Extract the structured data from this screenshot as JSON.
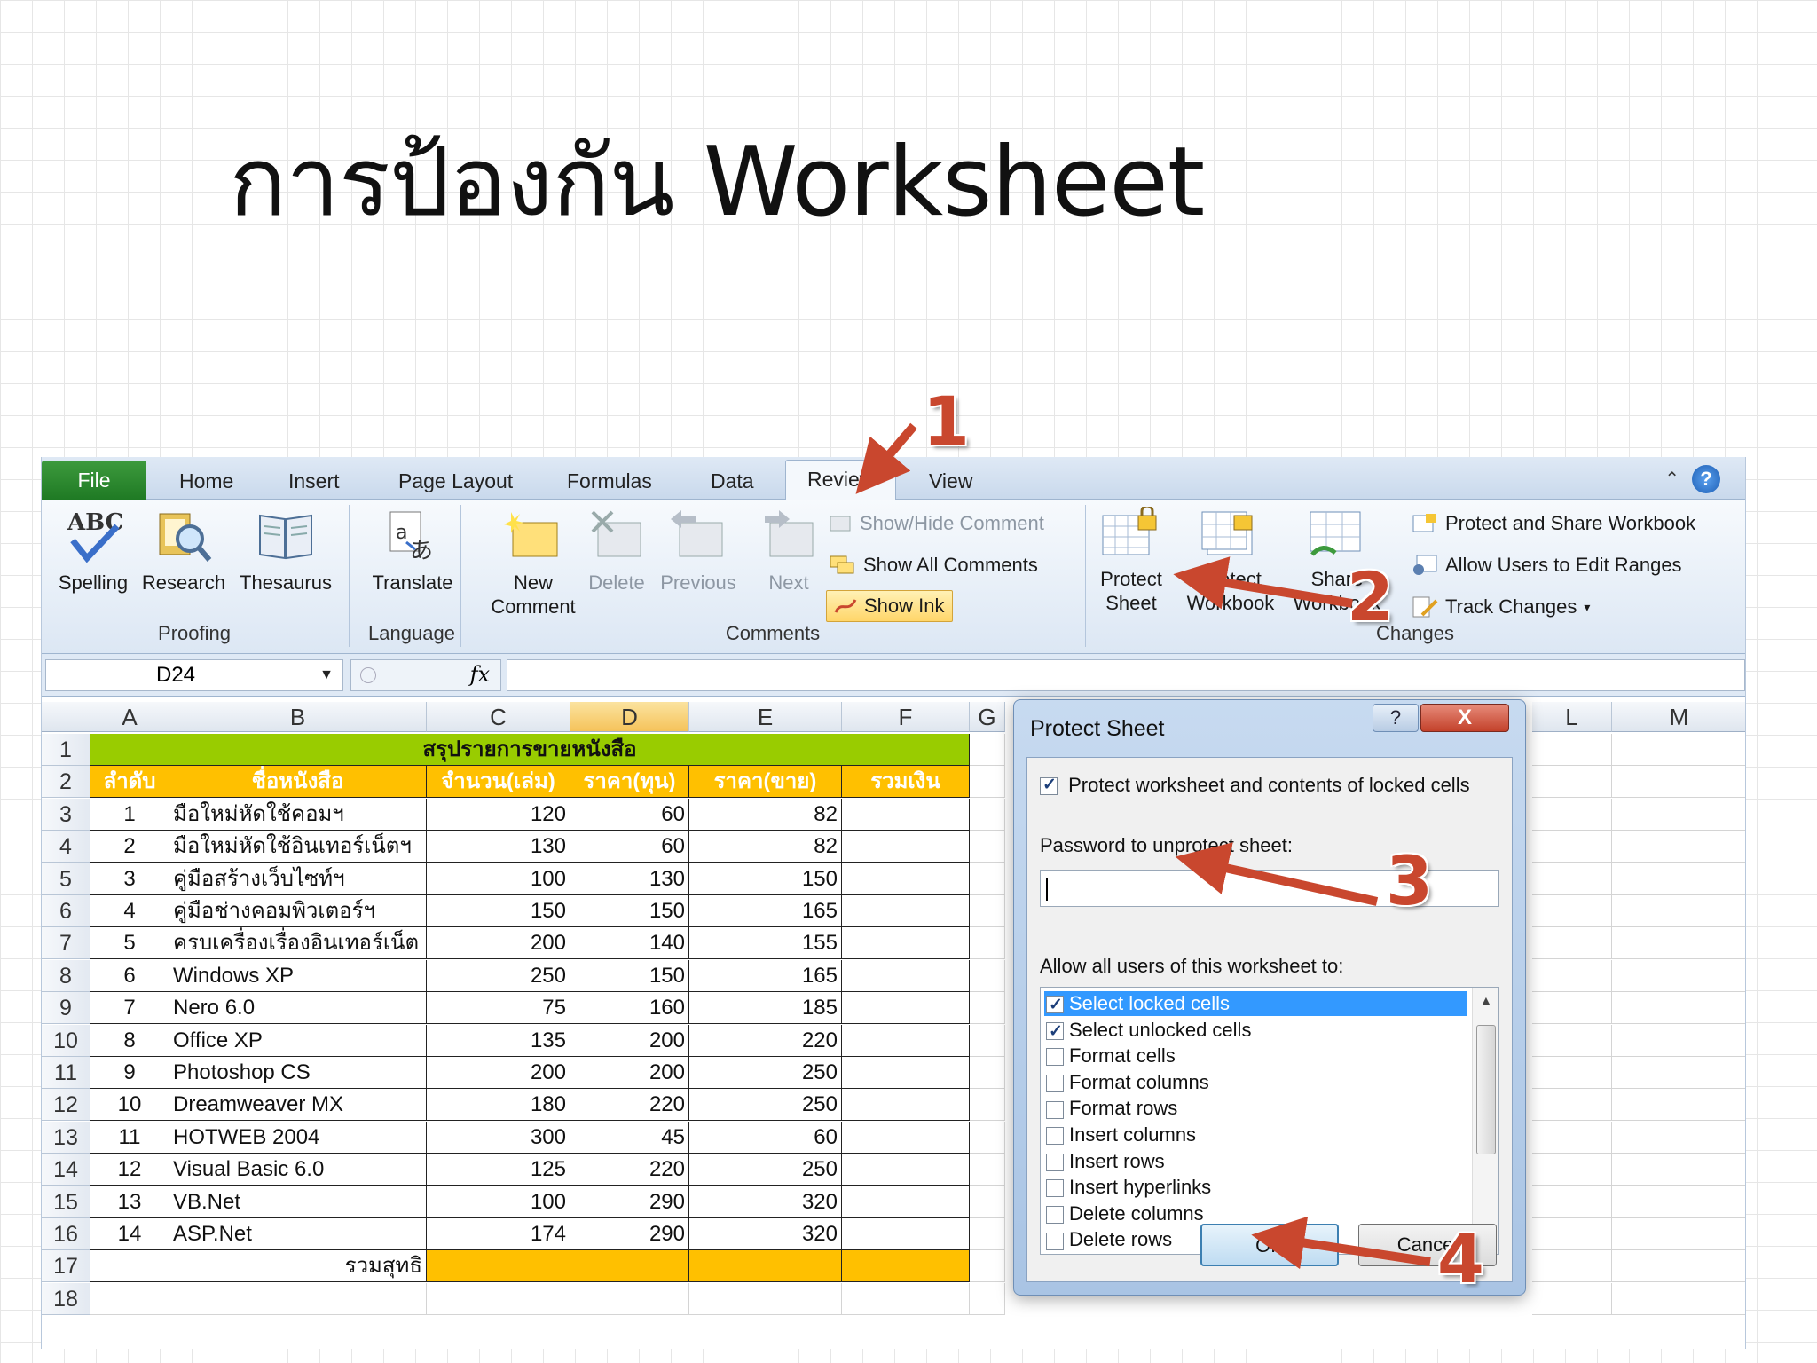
{
  "slide": {
    "title": "การป้องกัน Worksheet"
  },
  "excel": {
    "tabs": [
      "File",
      "Home",
      "Insert",
      "Page Layout",
      "Formulas",
      "Data",
      "Review",
      "View"
    ],
    "active_tab": "Review",
    "ribbon": {
      "proofing": {
        "label": "Proofing",
        "spelling": "Spelling",
        "research": "Research",
        "thesaurus": "Thesaurus"
      },
      "language": {
        "label": "Language",
        "translate": "Translate"
      },
      "comments": {
        "label": "Comments",
        "new_comment_1": "New",
        "new_comment_2": "Comment",
        "delete": "Delete",
        "previous": "Previous",
        "next": "Next",
        "show_hide": "Show/Hide Comment",
        "show_all": "Show All Comments",
        "show_ink": "Show Ink"
      },
      "changes": {
        "label": "Changes",
        "protect_sheet_1": "Protect",
        "protect_sheet_2": "Sheet",
        "protect_workbook_1": "Protect",
        "protect_workbook_2": "Workbook",
        "share_workbook_1": "Share",
        "share_workbook_2": "Workbook",
        "protect_share": "Protect and Share Workbook",
        "allow_users": "Allow Users to Edit Ranges",
        "track_changes": "Track Changes"
      }
    },
    "name_box": "D24",
    "columns": [
      "A",
      "B",
      "C",
      "D",
      "E",
      "F",
      "G",
      "L",
      "M"
    ],
    "rows": [
      "1",
      "2",
      "3",
      "4",
      "5",
      "6",
      "7",
      "8",
      "9",
      "10",
      "11",
      "12",
      "13",
      "14",
      "15",
      "16",
      "17",
      "18"
    ],
    "sheet": {
      "title_row": "สรุปรายการขายหนังสือ",
      "headers": [
        "ลำดับ",
        "ชื่อหนังสือ",
        "จำนวน(เล่ม)",
        "ราคา(ทุน)",
        "ราคา(ขาย)",
        "รวมเงิน"
      ],
      "data": [
        [
          "1",
          "มือใหม่หัดใช้คอมฯ",
          "120",
          "60",
          "82"
        ],
        [
          "2",
          "มือใหม่หัดใช้อินเทอร์เน็ตฯ",
          "130",
          "60",
          "82"
        ],
        [
          "3",
          "คู่มือสร้างเว็บไซท์ฯ",
          "100",
          "130",
          "150"
        ],
        [
          "4",
          "คู่มือช่างคอมพิวเตอร์ฯ",
          "150",
          "150",
          "165"
        ],
        [
          "5",
          "ครบเครื่องเรื่องอินเทอร์เน็ต",
          "200",
          "140",
          "155"
        ],
        [
          "6",
          "Windows XP",
          "250",
          "150",
          "165"
        ],
        [
          "7",
          "Nero 6.0",
          "75",
          "160",
          "185"
        ],
        [
          "8",
          "Office XP",
          "135",
          "200",
          "220"
        ],
        [
          "9",
          "Photoshop CS",
          "200",
          "200",
          "250"
        ],
        [
          "10",
          "Dreamweaver MX",
          "180",
          "220",
          "250"
        ],
        [
          "11",
          "HOTWEB 2004",
          "300",
          "45",
          "60"
        ],
        [
          "12",
          "Visual Basic 6.0",
          "125",
          "220",
          "250"
        ],
        [
          "13",
          "VB.Net",
          "100",
          "290",
          "320"
        ],
        [
          "14",
          "ASP.Net",
          "174",
          "290",
          "320"
        ]
      ],
      "total_label": "รวมสุทธิ"
    }
  },
  "dialog": {
    "title": "Protect Sheet",
    "help": "?",
    "close": "X",
    "protect_checkbox": "Protect worksheet and contents of locked cells",
    "password_label": "Password to unprotect sheet:",
    "allow_label": "Allow all users of this worksheet to:",
    "permissions": [
      {
        "label": "Select locked cells",
        "checked": true
      },
      {
        "label": "Select unlocked cells",
        "checked": true
      },
      {
        "label": "Format cells",
        "checked": false
      },
      {
        "label": "Format columns",
        "checked": false
      },
      {
        "label": "Format rows",
        "checked": false
      },
      {
        "label": "Insert columns",
        "checked": false
      },
      {
        "label": "Insert rows",
        "checked": false
      },
      {
        "label": "Insert hyperlinks",
        "checked": false
      },
      {
        "label": "Delete columns",
        "checked": false
      },
      {
        "label": "Delete rows",
        "checked": false
      }
    ],
    "ok": "OK",
    "cancel": "Cancel"
  },
  "annotations": [
    "1",
    "2",
    "3",
    "4"
  ],
  "colors": {
    "accent_green": "#99cc00",
    "accent_yellow": "#ffc000",
    "arrow": "#c9472e",
    "selection": "#3399ff"
  }
}
